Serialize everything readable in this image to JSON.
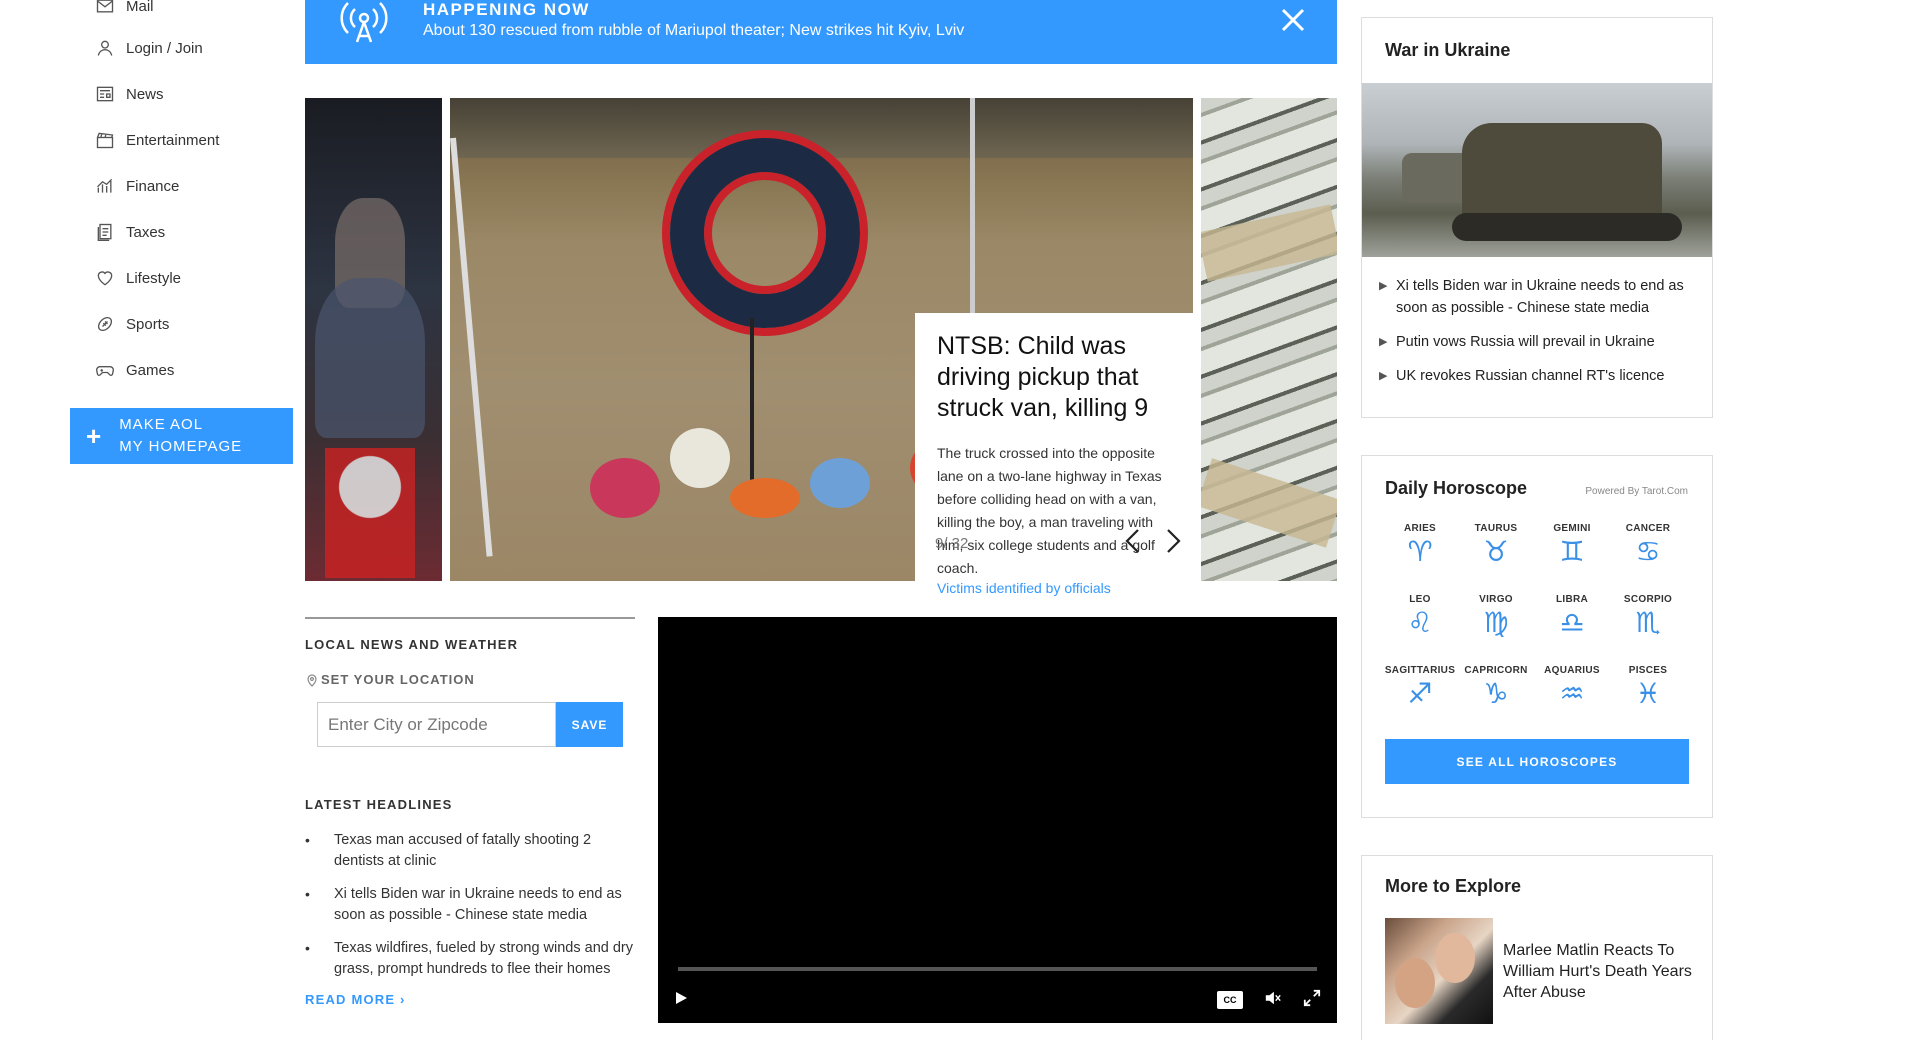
{
  "nav": {
    "items": [
      {
        "label": "Mail",
        "icon": "mail-icon"
      },
      {
        "label": "Login / Join",
        "icon": "user-icon"
      },
      {
        "label": "News",
        "icon": "newspaper-icon"
      },
      {
        "label": "Entertainment",
        "icon": "clapperboard-icon"
      },
      {
        "label": "Finance",
        "icon": "chart-icon"
      },
      {
        "label": "Taxes",
        "icon": "document-icon"
      },
      {
        "label": "Lifestyle",
        "icon": "heart-icon"
      },
      {
        "label": "Sports",
        "icon": "football-icon"
      },
      {
        "label": "Games",
        "icon": "gamepad-icon"
      }
    ],
    "make_home_line1": "Make AOL",
    "make_home_line2": "My Homepage"
  },
  "happening": {
    "title": "Happening Now",
    "text": "About 130 rescued from rubble of Mariupol theater; New strikes hit Kyiv, Lviv"
  },
  "carousel": {
    "headline": "NTSB: Child was driving pickup that struck van, killing 9",
    "summary": "The truck crossed into the opposite lane on a two-lane highway in Texas before colliding head on with a van, killing the boy, a man traveling with him, six college students and a golf coach.",
    "more_link": "Victims identified by officials",
    "counter": "9/ 32"
  },
  "local": {
    "title": "Local News and Weather",
    "set_location": "Set Your Location",
    "input_placeholder": "Enter City or Zipcode",
    "save_label": "Save",
    "latest_title": "Latest Headlines",
    "headlines": [
      "Texas man accused of fatally shooting 2 dentists at clinic",
      "Xi tells Biden war in Ukraine needs to end as soon as possible - Chinese state media",
      "Texas wildfires, fueled by strong winds and dry grass, prompt hundreds to flee their homes"
    ],
    "read_more": "Read More ›"
  },
  "video": {
    "cc_label": "CC"
  },
  "war": {
    "title": "War in Ukraine",
    "items": [
      "Xi tells Biden war in Ukraine needs to end as soon as possible - Chinese state media",
      "Putin vows Russia will prevail in Ukraine",
      "UK revokes Russian channel RT's licence"
    ]
  },
  "horoscope": {
    "title": "Daily Horoscope",
    "powered": "Powered By Tarot.Com",
    "signs": [
      {
        "name": "Aries",
        "glyph": "♈"
      },
      {
        "name": "Taurus",
        "glyph": "♉"
      },
      {
        "name": "Gemini",
        "glyph": "♊"
      },
      {
        "name": "Cancer",
        "glyph": "♋"
      },
      {
        "name": "Leo",
        "glyph": "♌"
      },
      {
        "name": "Virgo",
        "glyph": "♍"
      },
      {
        "name": "Libra",
        "glyph": "♎"
      },
      {
        "name": "Scorpio",
        "glyph": "♏"
      },
      {
        "name": "Sagittarius",
        "glyph": "♐"
      },
      {
        "name": "Capricorn",
        "glyph": "♑"
      },
      {
        "name": "Aquarius",
        "glyph": "♒"
      },
      {
        "name": "Pisces",
        "glyph": "♓"
      }
    ],
    "see_all": "See All Horoscopes"
  },
  "explore": {
    "title": "More to Explore",
    "item_text": "Marlee Matlin Reacts To William Hurt's Death Years After Abuse"
  },
  "colors": {
    "accent": "#3399ff",
    "glyph": "#3a8fe6"
  }
}
